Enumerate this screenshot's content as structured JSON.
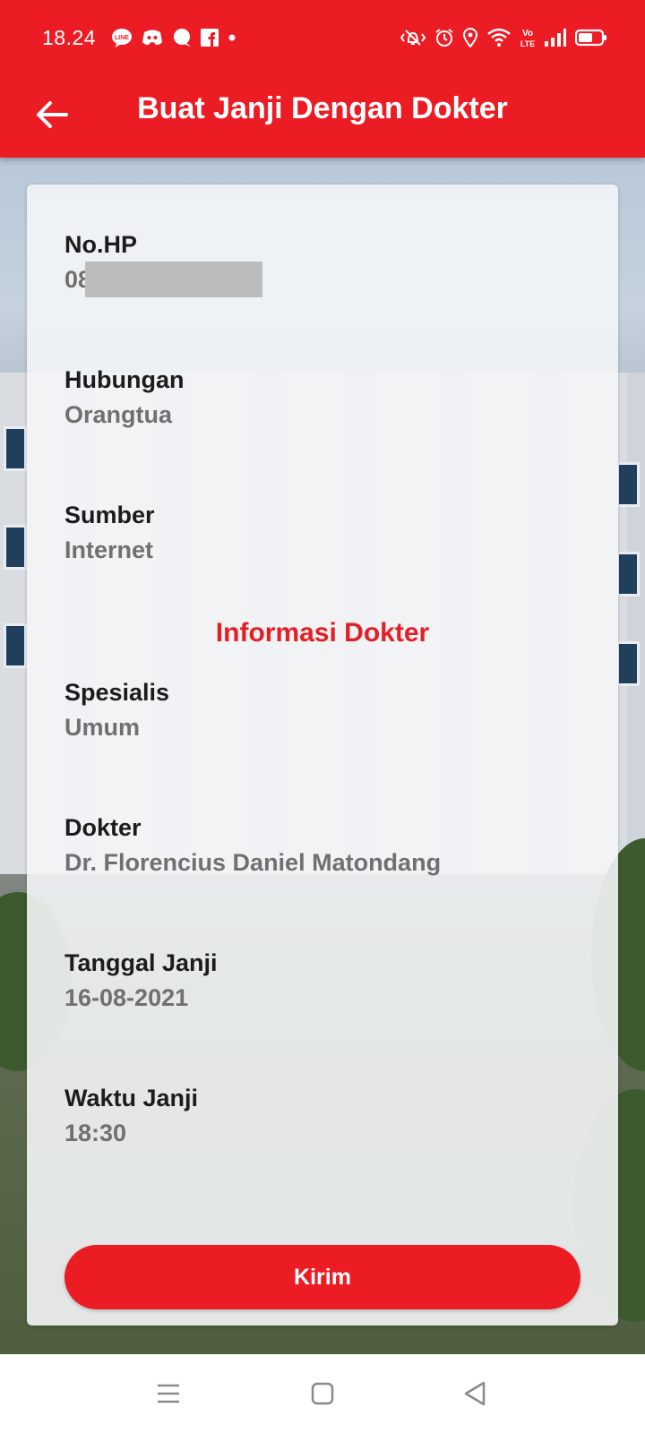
{
  "status_bar": {
    "time": "18.24",
    "left_icons": [
      "line-icon",
      "discord-icon",
      "chat-bubble-icon",
      "facebook-icon",
      "dot-icon"
    ],
    "right_icons": [
      "vibrate-icon",
      "alarm-icon",
      "location-icon",
      "wifi-icon",
      "volte-icon",
      "signal-icon",
      "battery-icon"
    ],
    "volte_text": "Vo LTE"
  },
  "app_bar": {
    "title": "Buat Janji Dengan Dokter",
    "back_icon": "arrow-left-icon"
  },
  "form": {
    "phone": {
      "label": "No.HP",
      "value": "08"
    },
    "relation": {
      "label": "Hubungan",
      "value": "Orangtua"
    },
    "source": {
      "label": "Sumber",
      "value": "Internet"
    },
    "doctor_section_title": "Informasi Dokter",
    "specialty": {
      "label": "Spesialis",
      "value": "Umum"
    },
    "doctor": {
      "label": "Dokter",
      "value": "Dr. Florencius Daniel Matondang"
    },
    "date": {
      "label": "Tanggal Janji",
      "value": "16-08-2021"
    },
    "time": {
      "label": "Waktu Janji",
      "value": "18:30"
    },
    "submit_label": "Kirim"
  },
  "nav_bar": {
    "buttons": [
      "menu-icon",
      "home-icon",
      "back-triangle-icon"
    ]
  },
  "colors": {
    "primary": "#ec1c24",
    "label_text": "#1c1c1c",
    "value_text": "#707070"
  }
}
